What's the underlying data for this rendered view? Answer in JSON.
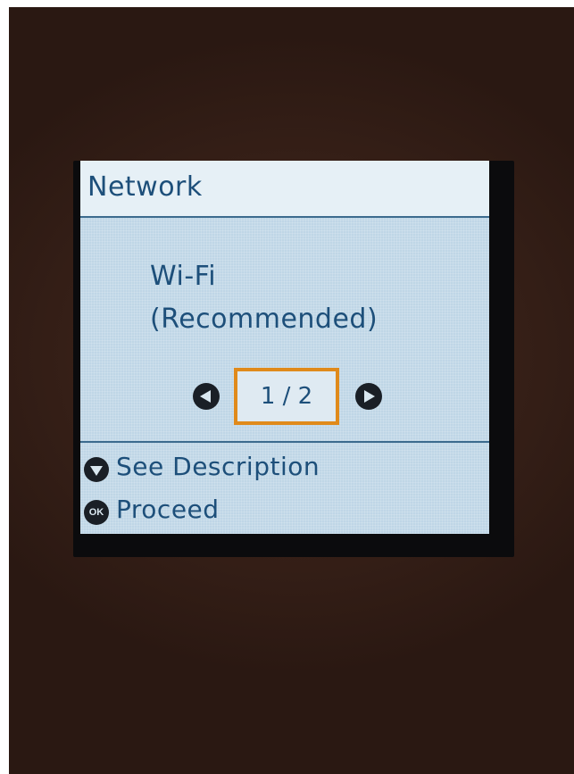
{
  "screen": {
    "title": "Network",
    "option": {
      "line1": "Wi-Fi",
      "line2": "(Recommended)"
    },
    "pager": {
      "text": "1 / 2",
      "current": 1,
      "total": 2,
      "prev_icon": "left-arrow-icon",
      "next_icon": "right-arrow-icon"
    },
    "hints": [
      {
        "icon": "down-arrow-icon",
        "label": "See Description"
      },
      {
        "icon": "ok-icon",
        "icon_text": "OK",
        "label": "Proceed"
      }
    ]
  },
  "colors": {
    "lcd_background": "#bfd6e6",
    "text": "#1d4f7a",
    "highlight": "#e08a1b",
    "bezel": "#0b0b0d",
    "surroundings": "#3a2219"
  }
}
